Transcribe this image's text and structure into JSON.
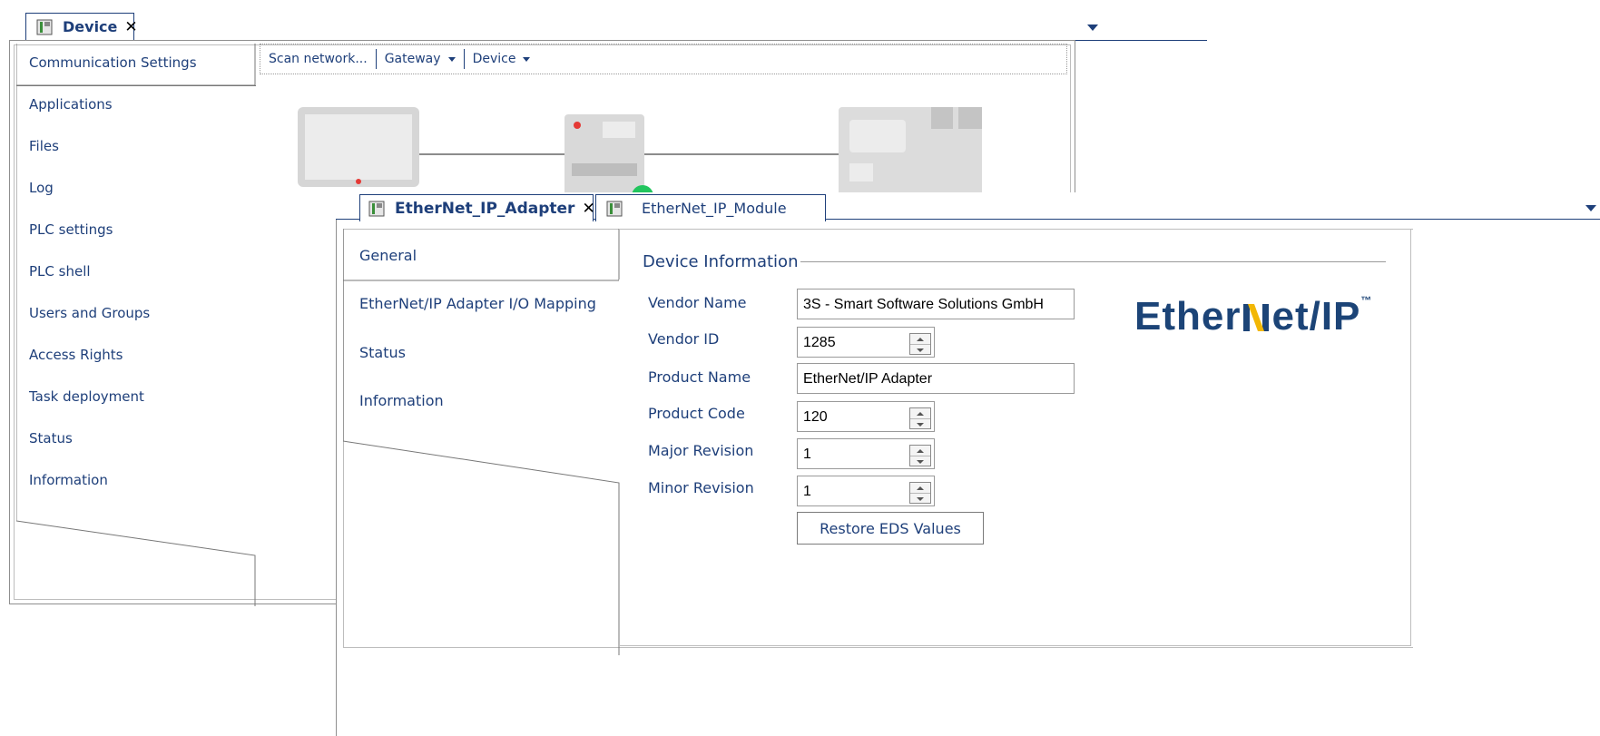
{
  "back_window": {
    "tab_title": "Device",
    "nav_items": [
      "Communication Settings",
      "Applications",
      "Files",
      "Log",
      "PLC settings",
      "PLC shell",
      "Users and Groups",
      "Access Rights",
      "Task deployment",
      "Status",
      "Information"
    ],
    "toolbar": {
      "scan_label": "Scan network...",
      "gateway_label": "Gateway",
      "device_label": "Device"
    }
  },
  "front_window": {
    "tabs": [
      "EtherNet_IP_Adapter",
      "EtherNet_IP_Module"
    ],
    "nav_items": [
      "General",
      "EtherNet/IP Adapter I/O Mapping",
      "Status",
      "Information"
    ],
    "section_title": "Device Information",
    "fields": {
      "vendor_name": {
        "label": "Vendor Name",
        "value": "3S - Smart Software Solutions GmbH"
      },
      "vendor_id": {
        "label": "Vendor ID",
        "value": "1285"
      },
      "product_name": {
        "label": "Product Name",
        "value": "EtherNet/IP Adapter"
      },
      "product_code": {
        "label": "Product Code",
        "value": "120"
      },
      "major_revision": {
        "label": "Major Revision",
        "value": "1"
      },
      "minor_revision": {
        "label": "Minor Revision",
        "value": "1"
      }
    },
    "restore_button": "Restore EDS Values",
    "logo": {
      "text_part1": "Ether",
      "text_part2": "et/IP",
      "trademark": "™"
    }
  },
  "colors": {
    "text_blue": "#1e3f7a",
    "status_green": "#22c55e",
    "device_red": "#e53935",
    "logo_blue": "#1c4477",
    "logo_yellow": "#f2b705"
  }
}
